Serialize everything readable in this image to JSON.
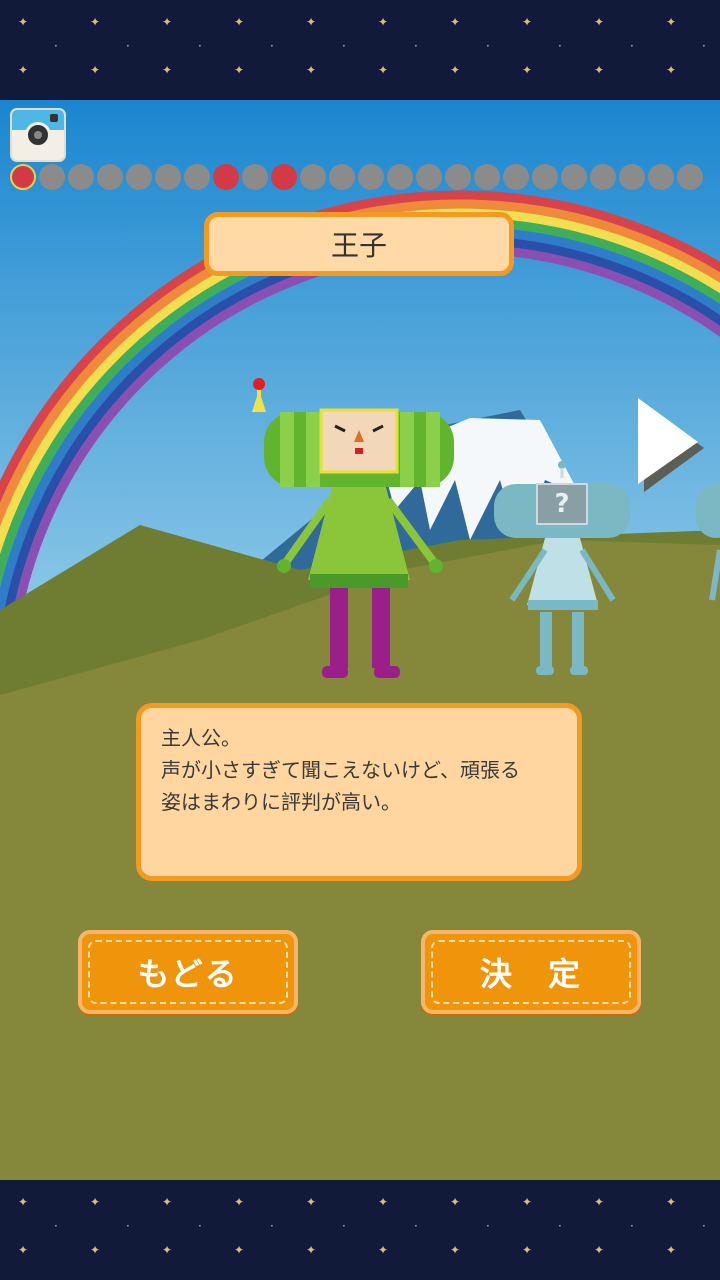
{
  "camera": {
    "icon": "camera-icon"
  },
  "progress": {
    "total": 24,
    "current_index": 0,
    "collected_indices": [
      0,
      7,
      9
    ]
  },
  "character": {
    "name": "王子",
    "description_lines": [
      "主人公。",
      "声が小さすぎて聞こえないけど、頑張る",
      "姿はまわりに評判が高い。"
    ]
  },
  "next_character": {
    "locked_mark": "?"
  },
  "buttons": {
    "back_label": "もどる",
    "confirm_label": "決　定"
  },
  "colors": {
    "accent_orange": "#f0940c",
    "panel_fill": "#ffd9a6",
    "sky_top": "#1a86cf",
    "hill": "#8a8a3a",
    "collected_dot": "#d23a45",
    "empty_dot": "#8b8b8b",
    "star_bar": "#121a3a"
  }
}
